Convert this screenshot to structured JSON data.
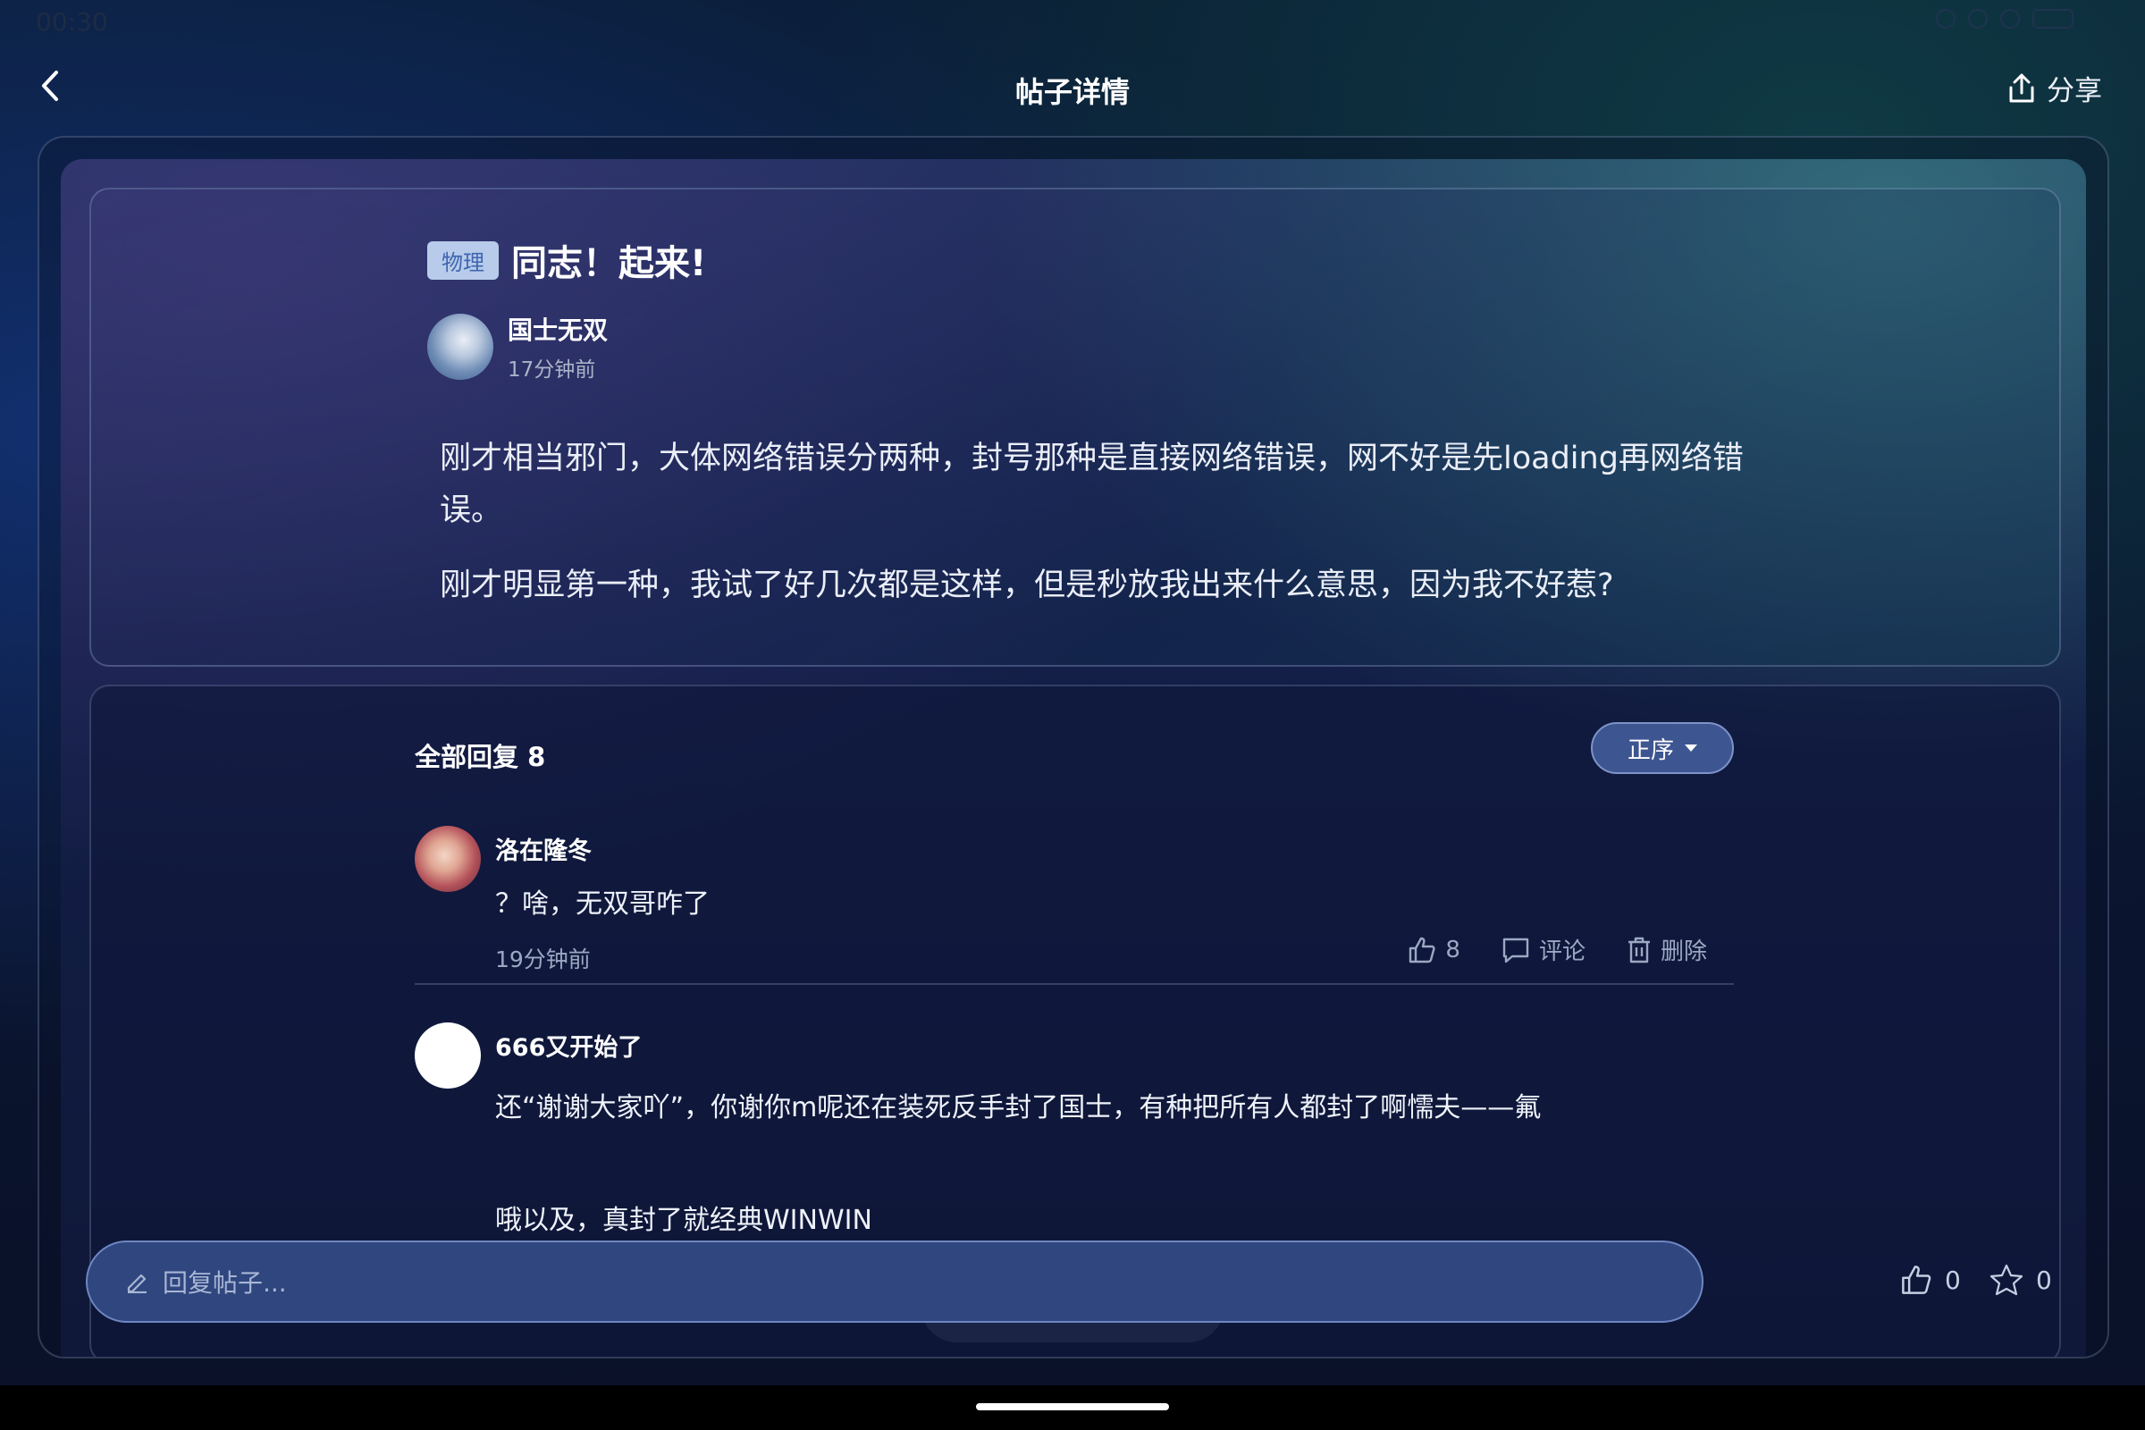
{
  "status_bar": {
    "time": "00:30"
  },
  "header": {
    "title": "帖子详情",
    "share_label": "分享"
  },
  "post": {
    "tag": "物理",
    "title": "同志！起来!",
    "author": {
      "name": "国士无双",
      "time": "17分钟前"
    },
    "paragraphs": [
      "刚才相当邪门，大体网络错误分两种，封号那种是直接网络错误，网不好是先loading再网络错误。",
      "刚才明显第一种，我试了好几次都是这样，但是秒放我出来什么意思，因为我不好惹?"
    ]
  },
  "replies": {
    "header": "全部回复 8",
    "sort_label": "正序",
    "items": [
      {
        "name": "洛在隆冬",
        "text": "？啥，无双哥咋了",
        "time": "19分钟前",
        "likes": "8",
        "comment_label": "评论",
        "delete_label": "删除"
      },
      {
        "name": "666又开始了",
        "text": "还“谢谢大家吖”，你谢你m呢还在装死反手封了国士，有种把所有人都封了啊懦夫——氟",
        "text2": "哦以及，真封了就经典WINWIN"
      }
    ]
  },
  "bottom_bar": {
    "placeholder": "回复帖子...",
    "like_count": "0",
    "star_count": "0"
  }
}
